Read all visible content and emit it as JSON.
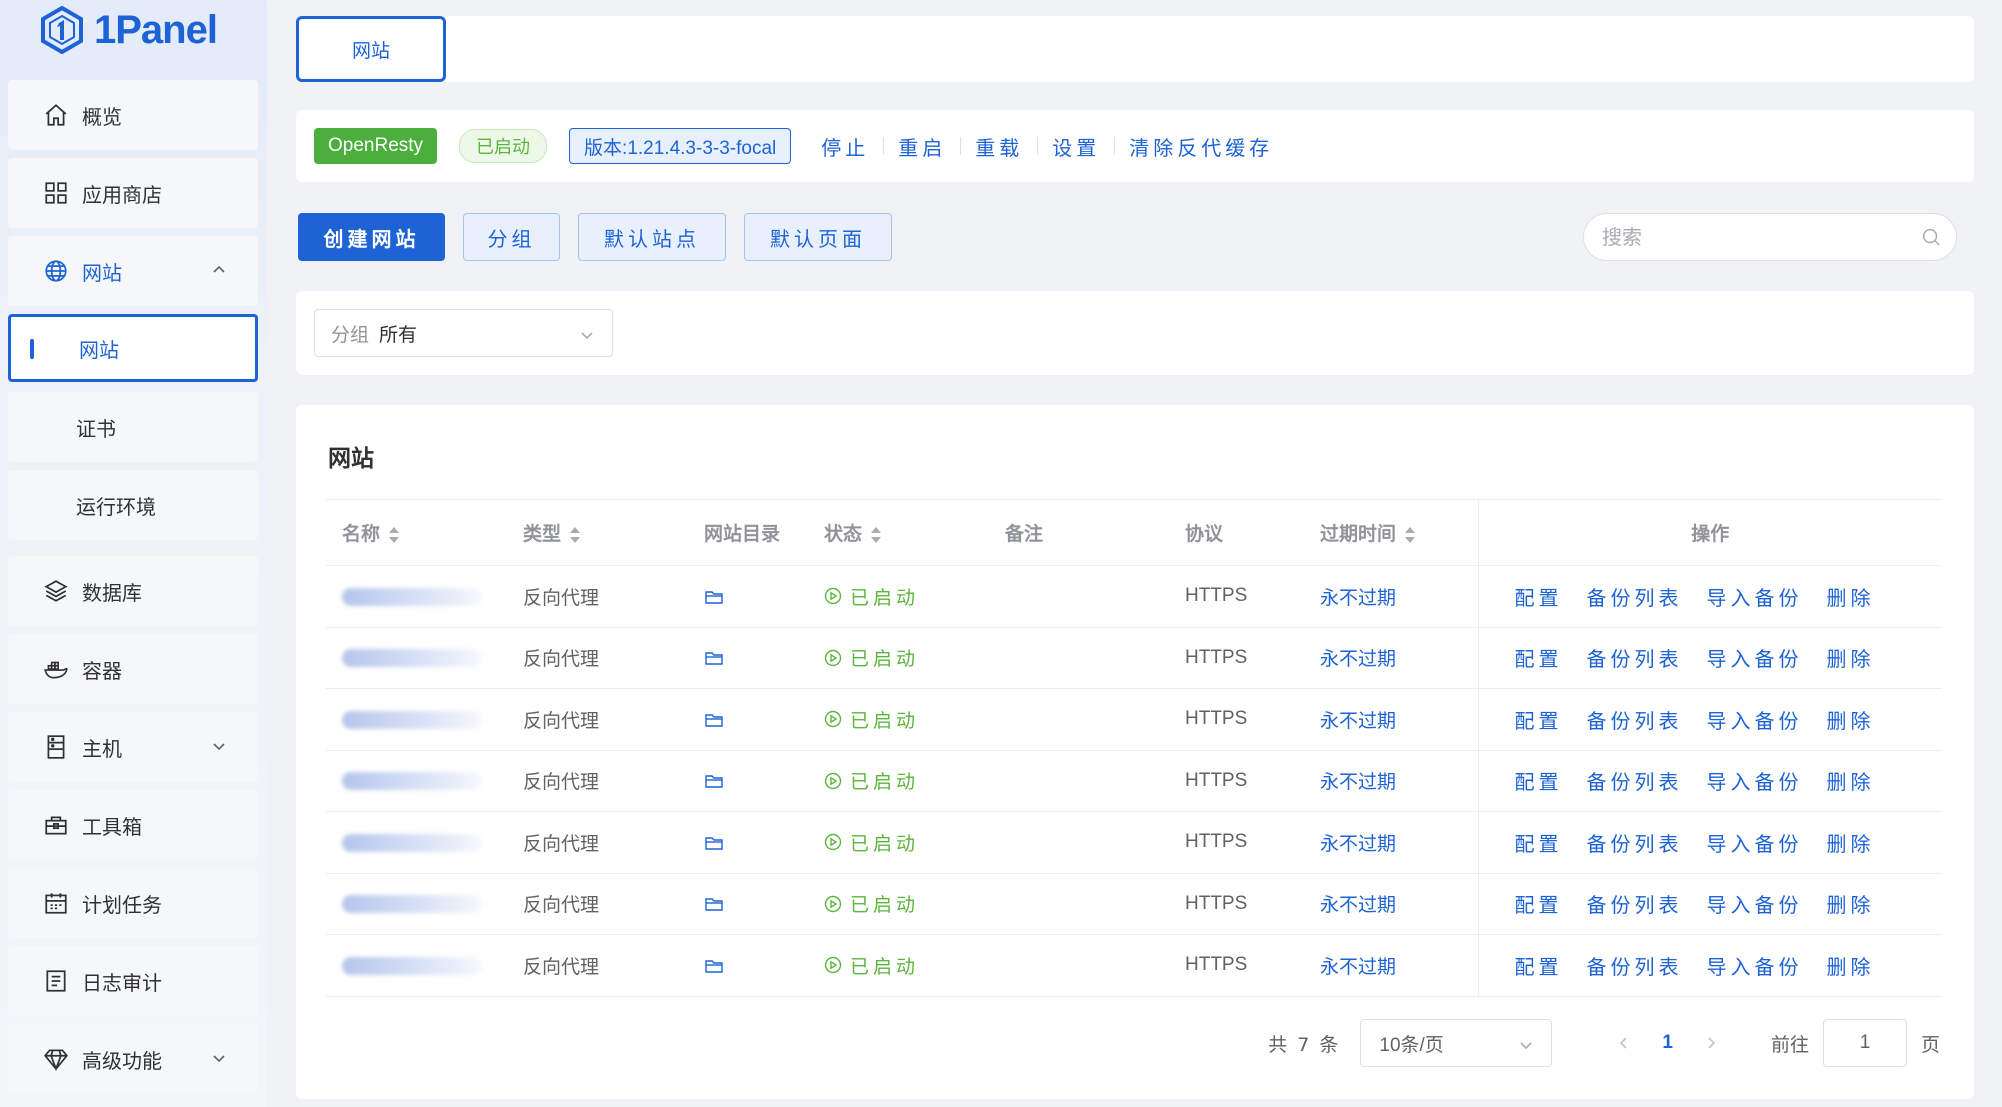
{
  "brand": {
    "name": "1Panel",
    "color": "#1d63d5"
  },
  "sidebar": {
    "items": [
      {
        "label": "概览",
        "icon": "home-icon"
      },
      {
        "label": "应用商店",
        "icon": "grid-icon"
      },
      {
        "label": "网站",
        "icon": "globe-icon",
        "expanded": true
      },
      {
        "label": "数据库",
        "icon": "layers-icon"
      },
      {
        "label": "容器",
        "icon": "docker-icon"
      },
      {
        "label": "主机",
        "icon": "server-icon"
      },
      {
        "label": "工具箱",
        "icon": "toolbox-icon"
      },
      {
        "label": "计划任务",
        "icon": "calendar-icon"
      },
      {
        "label": "日志审计",
        "icon": "log-icon"
      },
      {
        "label": "高级功能",
        "icon": "diamond-icon"
      }
    ],
    "website_sub": [
      {
        "label": "网站",
        "active": true
      },
      {
        "label": "证书"
      },
      {
        "label": "运行环境"
      }
    ]
  },
  "tabs": {
    "active": "网站"
  },
  "openresty": {
    "name": "OpenResty",
    "status": "已启动",
    "version": "版本:1.21.4.3-3-3-focal",
    "actions": [
      "停止",
      "重启",
      "重载",
      "设置",
      "清除反代缓存"
    ]
  },
  "toolbar": {
    "create": "创建网站",
    "group": "分组",
    "default_site": "默认站点",
    "default_page": "默认页面",
    "search_placeholder": "搜索"
  },
  "filter": {
    "prefix": "分组",
    "value": "所有"
  },
  "table": {
    "title": "网站",
    "columns": [
      "名称",
      "类型",
      "网站目录",
      "状态",
      "备注",
      "协议",
      "过期时间",
      "操作"
    ],
    "rows": [
      {
        "type": "反向代理",
        "status": "已启动",
        "remark": "",
        "protocol": "HTTPS",
        "expire": "永不过期"
      },
      {
        "type": "反向代理",
        "status": "已启动",
        "remark": "",
        "protocol": "HTTPS",
        "expire": "永不过期"
      },
      {
        "type": "反向代理",
        "status": "已启动",
        "remark": "",
        "protocol": "HTTPS",
        "expire": "永不过期"
      },
      {
        "type": "反向代理",
        "status": "已启动",
        "remark": "",
        "protocol": "HTTPS",
        "expire": "永不过期"
      },
      {
        "type": "反向代理",
        "status": "已启动",
        "remark": "",
        "protocol": "HTTPS",
        "expire": "永不过期"
      },
      {
        "type": "反向代理",
        "status": "已启动",
        "remark": "",
        "protocol": "HTTPS",
        "expire": "永不过期"
      },
      {
        "type": "反向代理",
        "status": "已启动",
        "remark": "",
        "protocol": "HTTPS",
        "expire": "永不过期"
      }
    ],
    "row_actions": [
      "配置",
      "备份列表",
      "导入备份",
      "删除"
    ]
  },
  "pagination": {
    "total": "共 7 条",
    "page_size": "10条/页",
    "current_page": "1",
    "jump_label": "前往",
    "jump_value": "1",
    "page_suffix": "页"
  },
  "colors": {
    "primary": "#1d63d5",
    "success": "#5cb53c",
    "openresty": "#4cae3c"
  }
}
